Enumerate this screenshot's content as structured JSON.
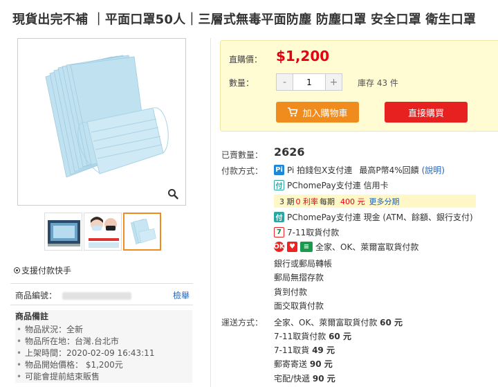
{
  "page": {
    "title": "現貨出完不補 ｜平面口罩50人｜三層式無毒平面防塵 防塵口罩 安全口罩 衛生口罩"
  },
  "gallery": {
    "thumb_count": 3,
    "active_thumb_index": 2,
    "fast_pay_label": "支援付款快手"
  },
  "product_info": {
    "id_label": "商品編號：",
    "report_label": "檢舉",
    "notes_title": "商品備註",
    "notes": [
      "物品狀況：全新",
      "物品所在地：台灣.台北市",
      "上架時間：2020-02-09 16:43:11",
      "物品開始價格： $1,200元",
      "可能會提前結束販售"
    ]
  },
  "buybox": {
    "price_label": "直購價：",
    "price": "$1,200",
    "qty_label": "數量：",
    "qty_value": "1",
    "minus": "-",
    "plus": "+",
    "stock_text": "庫存 43 件",
    "add_to_cart": "加入購物車",
    "buy_now": "直接購買",
    "colors": {
      "price": "#e60012",
      "cart": "#f08c1e",
      "buy": "#e6211f",
      "box_bg": "#fffbd3"
    }
  },
  "details": {
    "sold_label": "已賣數量：",
    "sold_count": "2626",
    "payment_label": "付款方式：",
    "payments": {
      "pi_text": "Pi 拍錢包X支付連",
      "pi_reward": "最高P幣4%回饋",
      "pi_explain": "(說明)",
      "pchome_card": "PChomePay支付連 信用卡",
      "install_a": "3 期",
      "install_zero": "0 利率",
      "install_b": "每期",
      "install_amount": "400 元",
      "install_more": "更多分期",
      "pchome_cash": "PChomePay支付連 現金 (ATM、餘額、銀行支付)",
      "seven_cod": "7-11取貨付款",
      "family_cod": "全家、OK、萊爾富取貨付款",
      "bank": "銀行或郵局轉帳",
      "post_cod": "郵局無摺存款",
      "home_cod": "貨到付款",
      "face": "面交取貨付款"
    },
    "shipping_label": "運送方式：",
    "shipping": [
      {
        "name": "全家、OK、萊爾富取貨付款",
        "fee": "60 元"
      },
      {
        "name": "7-11取貨付款",
        "fee": "60 元"
      },
      {
        "name": "7-11取貨",
        "fee": "49 元"
      },
      {
        "name": "郵寄寄送",
        "fee": "90 元"
      },
      {
        "name": "宅配/快遞",
        "fee": "90 元"
      }
    ]
  }
}
